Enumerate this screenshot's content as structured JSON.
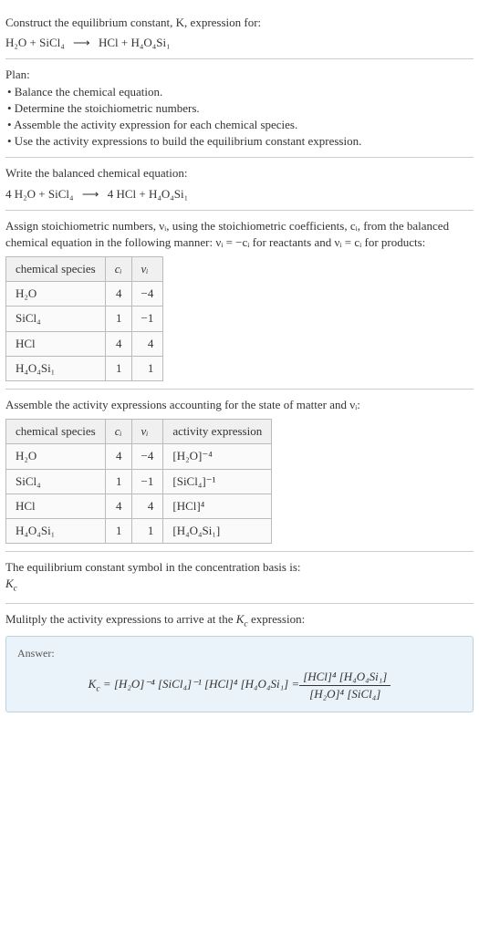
{
  "intro": {
    "prompt": "Construct the equilibrium constant, K, expression for:",
    "reaction_lhs": "H₂O + SiCl₄",
    "reaction_arrow": "⟶",
    "reaction_rhs": "HCl + H₄O₄Si₁"
  },
  "plan": {
    "title": "Plan:",
    "items": [
      "• Balance the chemical equation.",
      "• Determine the stoichiometric numbers.",
      "• Assemble the activity expression for each chemical species.",
      "• Use the activity expressions to build the equilibrium constant expression."
    ]
  },
  "balanced": {
    "title": "Write the balanced chemical equation:",
    "lhs": "4 H₂O + SiCl₄",
    "arrow": "⟶",
    "rhs": "4 HCl + H₄O₄Si₁"
  },
  "stoich": {
    "intro": "Assign stoichiometric numbers, νᵢ, using the stoichiometric coefficients, cᵢ, from the balanced chemical equation in the following manner: νᵢ = −cᵢ for reactants and νᵢ = cᵢ for products:",
    "headers": [
      "chemical species",
      "cᵢ",
      "νᵢ"
    ],
    "rows": [
      {
        "species": "H₂O",
        "c": "4",
        "v": "−4"
      },
      {
        "species": "SiCl₄",
        "c": "1",
        "v": "−1"
      },
      {
        "species": "HCl",
        "c": "4",
        "v": "4"
      },
      {
        "species": "H₄O₄Si₁",
        "c": "1",
        "v": "1"
      }
    ]
  },
  "activity": {
    "intro": "Assemble the activity expressions accounting for the state of matter and νᵢ:",
    "headers": [
      "chemical species",
      "cᵢ",
      "νᵢ",
      "activity expression"
    ],
    "rows": [
      {
        "species": "H₂O",
        "c": "4",
        "v": "−4",
        "expr": "[H₂O]⁻⁴"
      },
      {
        "species": "SiCl₄",
        "c": "1",
        "v": "−1",
        "expr": "[SiCl₄]⁻¹"
      },
      {
        "species": "HCl",
        "c": "4",
        "v": "4",
        "expr": "[HCl]⁴"
      },
      {
        "species": "H₄O₄Si₁",
        "c": "1",
        "v": "1",
        "expr": "[H₄O₄Si₁]"
      }
    ]
  },
  "symbol": {
    "text": "The equilibrium constant symbol in the concentration basis is:",
    "value": "K_c"
  },
  "multiply": {
    "text": "Mulitply the activity expressions to arrive at the K_c expression:"
  },
  "answer": {
    "label": "Answer:",
    "lhs": "K_c = [H₂O]⁻⁴ [SiCl₄]⁻¹ [HCl]⁴ [H₄O₄Si₁] =",
    "frac_num": "[HCl]⁴ [H₄O₄Si₁]",
    "frac_den": "[H₂O]⁴ [SiCl₄]"
  },
  "chart_data": {
    "type": "table",
    "tables": [
      {
        "title": "Stoichiometric numbers",
        "columns": [
          "chemical species",
          "c_i",
          "ν_i"
        ],
        "rows": [
          [
            "H2O",
            4,
            -4
          ],
          [
            "SiCl4",
            1,
            -1
          ],
          [
            "HCl",
            4,
            4
          ],
          [
            "H4O4Si1",
            1,
            1
          ]
        ]
      },
      {
        "title": "Activity expressions",
        "columns": [
          "chemical species",
          "c_i",
          "ν_i",
          "activity expression"
        ],
        "rows": [
          [
            "H2O",
            4,
            -4,
            "[H2O]^-4"
          ],
          [
            "SiCl4",
            1,
            -1,
            "[SiCl4]^-1"
          ],
          [
            "HCl",
            4,
            4,
            "[HCl]^4"
          ],
          [
            "H4O4Si1",
            1,
            1,
            "[H4O4Si1]"
          ]
        ]
      }
    ]
  }
}
